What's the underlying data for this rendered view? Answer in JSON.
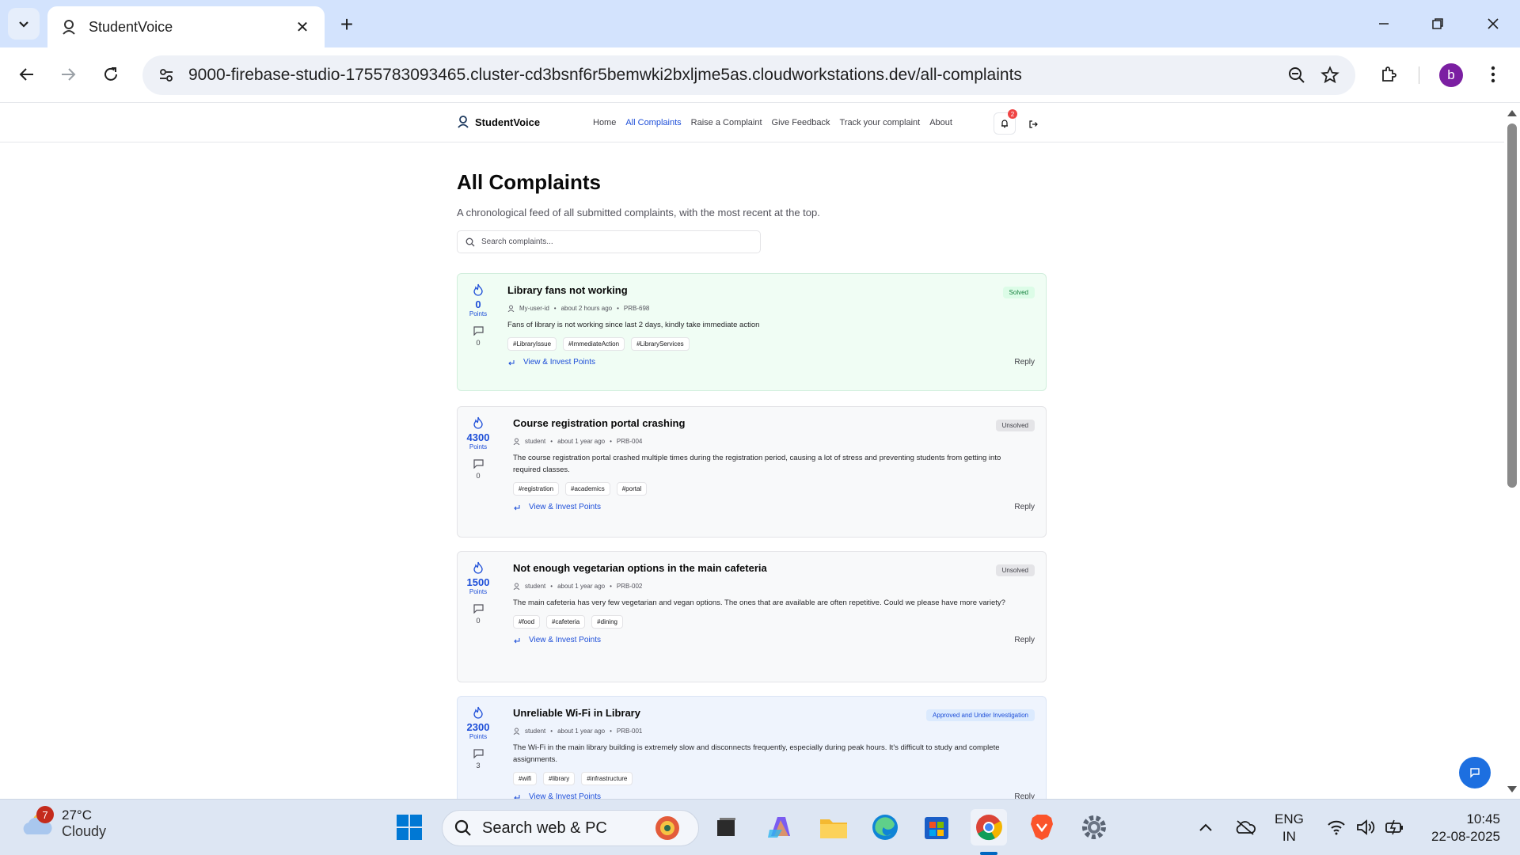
{
  "browser": {
    "tab_title": "StudentVoice",
    "url": "9000-firebase-studio-1755783093465.cluster-cd3bsnf6r5bemwki2bxljme5as.cloudworkstations.dev/all-complaints",
    "profile_initial": "b"
  },
  "site": {
    "brand": "StudentVoice",
    "nav": [
      "Home",
      "All Complaints",
      "Raise a Complaint",
      "Give Feedback",
      "Track your complaint",
      "About"
    ],
    "active_nav": "All Complaints",
    "notification_count": "2"
  },
  "page": {
    "title": "All Complaints",
    "subtitle": "A chronological feed of all submitted complaints, with the most recent at the top.",
    "search_placeholder": "Search complaints..."
  },
  "complaints": [
    {
      "title": "Library fans not working",
      "status": "Solved",
      "points": "0",
      "points_label": "Points",
      "comments": "0",
      "author": "My-user-id",
      "time": "about 2 hours ago",
      "id": "PRB-698",
      "description": "Fans of library is not working since last 2 days, kindly take immediate action",
      "tags": [
        "#LibraryIssue",
        "#ImmediateAction",
        "#LibraryServices"
      ],
      "action": "View & Invest Points",
      "reply": "Reply"
    },
    {
      "title": "Course registration portal crashing",
      "status": "Unsolved",
      "points": "4300",
      "points_label": "Points",
      "comments": "0",
      "author": "student",
      "time": "about 1 year ago",
      "id": "PRB-004",
      "description": "The course registration portal crashed multiple times during the registration period, causing a lot of stress and preventing students from getting into required classes.",
      "tags": [
        "#registration",
        "#academics",
        "#portal"
      ],
      "action": "View & Invest Points",
      "reply": "Reply"
    },
    {
      "title": "Not enough vegetarian options in the main cafeteria",
      "status": "Unsolved",
      "points": "1500",
      "points_label": "Points",
      "comments": "0",
      "author": "student",
      "time": "about 1 year ago",
      "id": "PRB-002",
      "description": "The main cafeteria has very few vegetarian and vegan options. The ones that are available are often repetitive. Could we please have more variety?",
      "tags": [
        "#food",
        "#cafeteria",
        "#dining"
      ],
      "action": "View & Invest Points",
      "reply": "Reply"
    },
    {
      "title": "Unreliable Wi-Fi in Library",
      "status": "Approved and Under Investigation",
      "points": "2300",
      "points_label": "Points",
      "comments": "3",
      "author": "student",
      "time": "about 1 year ago",
      "id": "PRB-001",
      "description": "The Wi-Fi in the main library building is extremely slow and disconnects frequently, especially during peak hours. It's difficult to study and complete assignments.",
      "tags": [
        "#wifi",
        "#library",
        "#infrastructure"
      ],
      "action": "View & Invest Points",
      "reply": "Reply"
    }
  ],
  "taskbar": {
    "weather_badge": "7",
    "temperature": "27°C",
    "condition": "Cloudy",
    "search_placeholder": "Search web & PC",
    "lang_1": "ENG",
    "lang_2": "IN",
    "time": "10:45",
    "date": "22-08-2025"
  },
  "colors": {
    "accent": "#1d4ed8",
    "solved_bg": "#f0fdf4",
    "investigating_bg": "#eff4fd",
    "tabbar": "#d3e3fd"
  }
}
